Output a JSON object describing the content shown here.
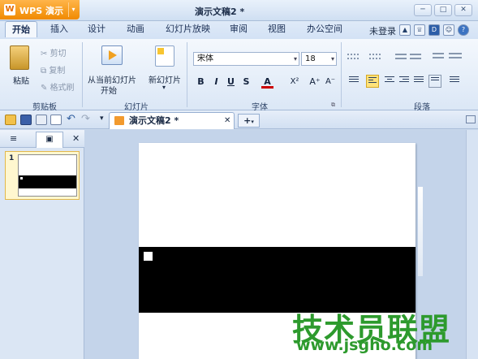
{
  "app": {
    "menu_label": "WPS 演示",
    "logo_glyph": "W",
    "menu_arrow": "▾",
    "doc_title": "演示文稿2 *"
  },
  "window": {
    "minimize": "─",
    "restore": "□",
    "close": "✕"
  },
  "tabs": [
    "开始",
    "插入",
    "设计",
    "动画",
    "幻灯片放映",
    "审阅",
    "视图",
    "办公空间"
  ],
  "user": {
    "login": "未登录",
    "help": "?"
  },
  "ribbon": {
    "clipboard": {
      "paste": "粘贴",
      "cut": "剪切",
      "copy": "复制",
      "format_painter": "格式刷",
      "group": "剪贴板"
    },
    "slides": {
      "from_current_line1": "从当前幻灯片",
      "from_current_line2": "开始",
      "new_slide": "新幻灯片",
      "group": "幻灯片"
    },
    "font": {
      "font_name": "宋体",
      "font_size": "18",
      "bold": "B",
      "italic": "I",
      "underline": "U",
      "strike": "S",
      "font_color": "A",
      "superscript": "X²",
      "grow": "A⁺",
      "shrink": "A⁻",
      "group": "字体"
    },
    "paragraph": {
      "group": "段落"
    }
  },
  "doc_tab": {
    "label": "演示文稿2 *",
    "close": "✕",
    "new": "+"
  },
  "left_panel": {
    "tab_outline": "≡",
    "tab_slides": "▣",
    "close": "✕",
    "slide_number": "1"
  },
  "watermark": {
    "text": "技术员联盟",
    "url": "www.jsgho.com"
  },
  "colors": {
    "accent_orange": "#f08a00",
    "ribbon_blue": "#dbe7f6",
    "watermark_green": "#2d9a2d"
  }
}
